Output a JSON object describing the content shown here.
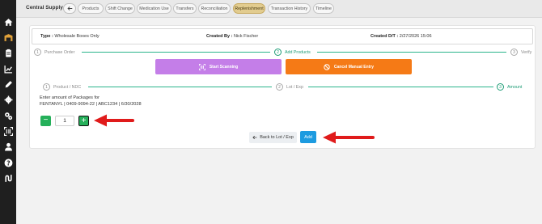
{
  "sidebar": {
    "icons": [
      "home-icon",
      "warehouse-icon",
      "clipboard-icon",
      "chart-icon",
      "edit-icon",
      "gear-icon",
      "gears-icon",
      "scan-icon",
      "user-icon",
      "help-icon",
      "route-icon"
    ]
  },
  "header": {
    "app_title": "Central Supply",
    "tabs": [
      {
        "label": "Products",
        "active": false
      },
      {
        "label": "Shift Change",
        "active": false
      },
      {
        "label": "Medication Use",
        "active": false
      },
      {
        "label": "Transfers",
        "active": false
      },
      {
        "label": "Reconciliation",
        "active": false
      },
      {
        "label": "Replenishment",
        "active": true
      },
      {
        "label": "Transaction History",
        "active": false
      },
      {
        "label": "Timeline",
        "active": false
      }
    ]
  },
  "info": {
    "type_label": "Type :",
    "type_value": "Wholesale Boxes Only",
    "created_by_label": "Created By :",
    "created_by_value": "Nick Fischer",
    "created_dt_label": "Created D/T :",
    "created_dt_value": "2/27/2026 15:06"
  },
  "main_steps": [
    {
      "num": "1",
      "label": "Purchase Order"
    },
    {
      "num": "2",
      "label": "Add Products"
    },
    {
      "num": "3",
      "label": "Verify"
    }
  ],
  "actions": {
    "start_scanning": "Start Scanning",
    "cancel_manual": "Cancel Manual Entry"
  },
  "sub_steps": [
    {
      "num": "1",
      "label": "Product / NDC"
    },
    {
      "num": "2",
      "label": "Lot / Exp"
    },
    {
      "num": "3",
      "label": "Amount"
    }
  ],
  "amount": {
    "prompt": "Enter amount of Packages for",
    "product_line": "FENTANYL | 0409-9094-22 | ABC1234 | 6/30/2028",
    "quantity": "1",
    "minus": "−",
    "plus": "+"
  },
  "buttons": {
    "back_to_lot": "Back to Lot / Exp",
    "add": "Add"
  },
  "colors": {
    "sidebar": "#1f1f1f",
    "active_tab": "#e2cc8f",
    "accent_green": "#1c9c75",
    "stepper_green": "#25b05a",
    "scan_purple": "#c47ee8",
    "cancel_orange": "#f57a16",
    "add_blue": "#1d9be0",
    "annotation_red": "#e01b1b"
  }
}
